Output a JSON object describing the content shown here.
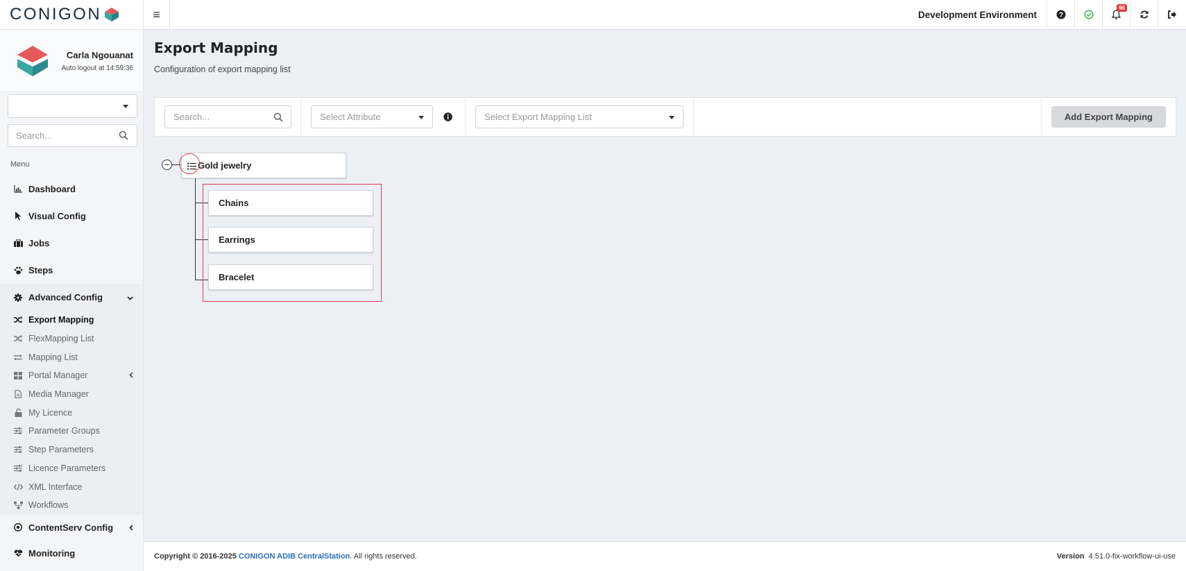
{
  "topbar": {
    "logo_text": "CONIGON",
    "environment": "Development Environment",
    "notification_count": "96"
  },
  "user": {
    "name": "Carla Ngouanat",
    "auto_logout": "Auto logout at 14:59:36"
  },
  "sidebar": {
    "select_value": "",
    "search_placeholder": "Search...",
    "menu_label": "Menu",
    "items": [
      {
        "label": "Dashboard",
        "icon": "bar-chart-icon"
      },
      {
        "label": "Visual Config",
        "icon": "cursor-icon"
      },
      {
        "label": "Jobs",
        "icon": "briefcase-icon"
      },
      {
        "label": "Steps",
        "icon": "paw-icon"
      },
      {
        "label": "Advanced Config",
        "icon": "gear-icon",
        "expanded": true
      }
    ],
    "advanced_sub": [
      {
        "label": "Export Mapping",
        "icon": "shuffle-icon",
        "active": true
      },
      {
        "label": "FlexMapping List",
        "icon": "shuffle-icon"
      },
      {
        "label": "Mapping List",
        "icon": "swap-icon"
      },
      {
        "label": "Portal Manager",
        "icon": "grid-icon",
        "has_children": true
      },
      {
        "label": "Media Manager",
        "icon": "file-icon"
      },
      {
        "label": "My Licence",
        "icon": "unlock-icon"
      },
      {
        "label": "Parameter Groups",
        "icon": "sliders-icon"
      },
      {
        "label": "Step Parameters",
        "icon": "sliders-icon"
      },
      {
        "label": "Licence Parameters",
        "icon": "sliders-icon"
      },
      {
        "label": "XML Interface",
        "icon": "code-icon"
      },
      {
        "label": "Workflows",
        "icon": "sitemap-icon"
      }
    ],
    "bottom_items": [
      {
        "label": "ContentServ Config",
        "icon": "target-icon"
      },
      {
        "label": "Monitoring",
        "icon": "heartbeat-icon"
      }
    ]
  },
  "main": {
    "title": "Export Mapping",
    "subtitle": "Configuration of export mapping list",
    "toolbar": {
      "search_placeholder": "Search...",
      "attribute_placeholder": "Select Attribute",
      "list_placeholder": "Select Export Mapping List",
      "add_button": "Add Export Mapping"
    },
    "tree": {
      "root": "Gold jewelry",
      "children": [
        "Chains",
        "Earrings",
        "Bracelet"
      ]
    }
  },
  "footer": {
    "copyright_prefix": "Copyright © 2016-2025 ",
    "company": "CONIGON ADIB CentralStation",
    "copyright_suffix": ". All rights reserved.",
    "version_label": "Version",
    "version_value": "4.51.0-fix-workflow-ui-use"
  },
  "colors": {
    "accent_red": "#e03a4d",
    "link_blue": "#2a6ebb",
    "status_green": "#2db34a",
    "badge_red": "#dd3b3b"
  }
}
